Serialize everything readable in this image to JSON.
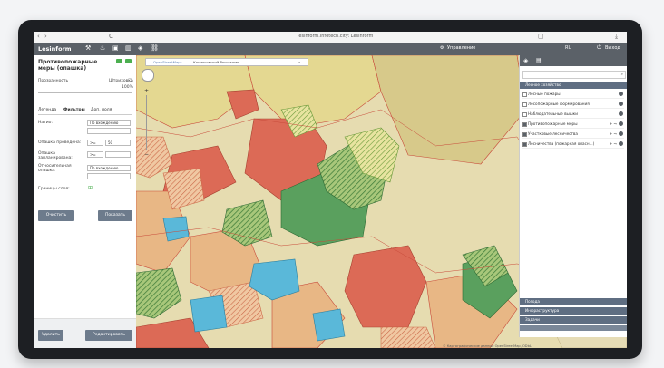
{
  "browser": {
    "back": "‹",
    "refresh": "C",
    "url": "lesinform.infotech.city: Lesinform",
    "icon_window": "▢",
    "icon_download": "⤓",
    "icon_forward": "›"
  },
  "app": {
    "logo": "Lesinform",
    "toolbar_icons": [
      "measure-icon",
      "fire-icon",
      "bookmark-icon",
      "chart-icon",
      "layers-icon",
      "link-icon"
    ],
    "management_label": "Управление",
    "language_label": "RU",
    "logout_label": "Выход",
    "gear_icon": "⚙",
    "power_icon": "⏻"
  },
  "panel": {
    "title": "Противопожарные меры (опашка)",
    "transparency_label": "Прозрачность",
    "fill_label": "Штриховка",
    "transparency_value": "100%",
    "tabs": [
      "Легенда",
      "Фильтры",
      "Доп. поля"
    ],
    "filters": [
      {
        "label": "Натио:",
        "value": "По вхождению"
      },
      {
        "label": "Опашка проведена:",
        "op": ">=",
        "value": "50"
      },
      {
        "label": "Опашка запланирована:",
        "op": ">=",
        "value": ""
      },
      {
        "label": "Относительная опашка:",
        "value": "По вхождению"
      }
    ],
    "boundary_label": "Границы слоя:",
    "clear_button": "Очистить",
    "show_button": "Показать",
    "delete_button": "Удалить",
    "edit_button": "Редактировать"
  },
  "map": {
    "search_source": "OpenStreetMaps",
    "search_text": "Космосовский Россокомо",
    "attribution": "© Картографические данные OpenStreetMap, ODbL",
    "zoom_in": "+",
    "zoom_out": "−",
    "region_colors": {
      "yellow": "#e4d891",
      "tan": "#e8b785",
      "red": "#dc6a56",
      "green": "#5aa05e",
      "blue": "#5ab8d9",
      "hatch": "#4c8a3f"
    }
  },
  "layers_panel": {
    "group_open": "Лесное хозяйство",
    "items": [
      {
        "label": "Лесные пожары",
        "checked": false
      },
      {
        "label": "Лесопожарные формирования",
        "checked": false
      },
      {
        "label": "Наблюдательные вышки",
        "checked": false
      },
      {
        "label": "Противопожарные меры",
        "checked": true
      },
      {
        "label": "Участковые лесничества",
        "checked": true
      },
      {
        "label": "Лесничества (пожарная опасн...)",
        "checked": true
      }
    ],
    "groups_collapsed": [
      "Погода",
      "Инфраструктура",
      "Задачи"
    ]
  }
}
